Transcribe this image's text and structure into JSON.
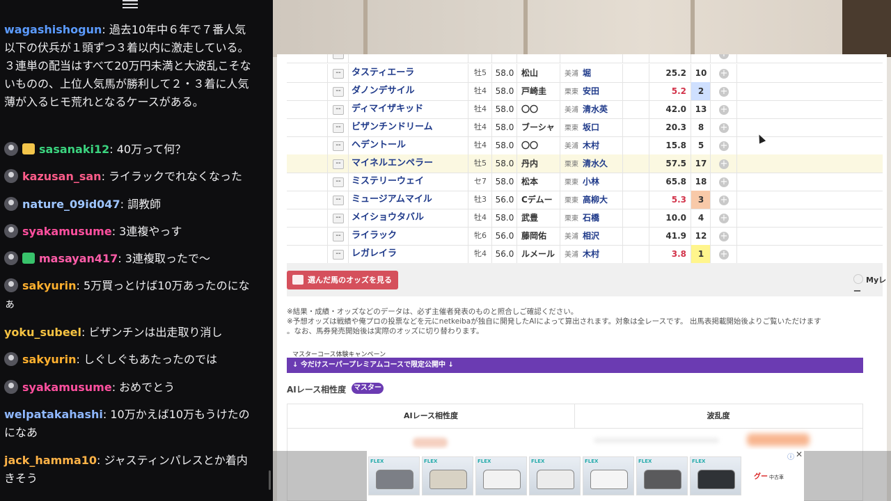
{
  "chat": {
    "messages": [
      {
        "user": "wagashishogun",
        "text": "過去10年中６年で７番人気以下の伏兵が１頭ずつ３着以内に激走している。３連単の配当はすべて20万円未満と大波乱こそないものの、上位人気馬が勝利して２・３着に人気薄が入るヒモ荒れとなるケースがある。",
        "color": "#5b9bff",
        "avatar": false,
        "badge": ""
      },
      {
        "user": "sasanaki12",
        "text": "40万って何？",
        "color": "#3bd47f",
        "avatar": true,
        "badge": "gift"
      },
      {
        "user": "kazusan_san",
        "text": "ライラックでれなくなった",
        "color": "#ff5c8a",
        "avatar": true,
        "badge": ""
      },
      {
        "user": "nature_09id047",
        "text": "調教師",
        "color": "#9ec5ff",
        "avatar": true,
        "badge": ""
      },
      {
        "user": "syakamusume",
        "text": "3連複やっす",
        "color": "#ff4f9e",
        "avatar": true,
        "badge": ""
      },
      {
        "user": "masayan417",
        "text": "3連複取ったで〜",
        "color": "#ff5ca8",
        "avatar": true,
        "badge": "green"
      },
      {
        "user": "sakyurin",
        "text": "5万買っとけば10万あったのになぁ",
        "color": "#ffb02e",
        "avatar": true,
        "badge": ""
      },
      {
        "user": "yoku_subeel",
        "text": "ビザンチンは出走取り消し",
        "color": "#f5c242",
        "avatar": false,
        "badge": ""
      },
      {
        "user": "sakyurin",
        "text": "しぐしぐもあたったのでは",
        "color": "#ffb02e",
        "avatar": true,
        "badge": ""
      },
      {
        "user": "syakamusume",
        "text": "おめでとう",
        "color": "#ff4f9e",
        "avatar": true,
        "badge": ""
      },
      {
        "user": "welpatakahashi",
        "text": "10万かえば10万もうけたのになあ",
        "color": "#8fb8ff",
        "avatar": false,
        "badge": ""
      },
      {
        "user": "jack_hamma10",
        "text": "ジャスティンパレスとか着内きそう",
        "color": "#ffb347",
        "avatar": false,
        "badge": ""
      }
    ]
  },
  "table": {
    "rows": [
      {
        "mark": "--",
        "name": "タスティエーラ",
        "sex": "牡5",
        "weight": "58.0",
        "jockey": "松山",
        "loc": "美浦",
        "trainer": "堀",
        "odds": "25.2",
        "pop": "10",
        "odds_red": false,
        "pop_class": ""
      },
      {
        "mark": "--",
        "name": "ダノンデサイル",
        "sex": "牡4",
        "weight": "58.0",
        "jockey": "戸崎圭",
        "loc": "栗東",
        "trainer": "安田",
        "odds": "5.2",
        "pop": "2",
        "odds_red": true,
        "pop_class": "p2"
      },
      {
        "mark": "--",
        "name": "ディマイザキッド",
        "sex": "牡4",
        "weight": "58.0",
        "jockey": "〇〇",
        "loc": "美浦",
        "trainer": "清水英",
        "odds": "42.0",
        "pop": "13",
        "odds_red": false,
        "pop_class": ""
      },
      {
        "mark": "--",
        "name": "ビザンチンドリーム",
        "sex": "牡4",
        "weight": "58.0",
        "jockey": "ブーシャ",
        "loc": "栗東",
        "trainer": "坂口",
        "odds": "20.3",
        "pop": "8",
        "odds_red": false,
        "pop_class": ""
      },
      {
        "mark": "--",
        "name": "ヘデントール",
        "sex": "牡4",
        "weight": "58.0",
        "jockey": "〇〇",
        "loc": "美浦",
        "trainer": "木村",
        "odds": "15.8",
        "pop": "5",
        "odds_red": false,
        "pop_class": ""
      },
      {
        "mark": "--",
        "name": "マイネルエンペラー",
        "sex": "牡5",
        "weight": "58.0",
        "jockey": "丹内",
        "loc": "栗東",
        "trainer": "清水久",
        "odds": "57.5",
        "pop": "17",
        "odds_red": false,
        "pop_class": "",
        "highlight": true
      },
      {
        "mark": "--",
        "name": "ミステリーウェイ",
        "sex": "セ7",
        "weight": "58.0",
        "jockey": "松本",
        "loc": "栗東",
        "trainer": "小林",
        "odds": "65.8",
        "pop": "18",
        "odds_red": false,
        "pop_class": ""
      },
      {
        "mark": "--",
        "name": "ミュージアムマイル",
        "sex": "牡3",
        "weight": "56.0",
        "jockey": "Cデムー",
        "loc": "栗東",
        "trainer": "高柳大",
        "odds": "5.3",
        "pop": "3",
        "odds_red": true,
        "pop_class": "p3"
      },
      {
        "mark": "--",
        "name": "メイショウタバル",
        "sex": "牡4",
        "weight": "58.0",
        "jockey": "武豊",
        "loc": "栗東",
        "trainer": "石橋",
        "odds": "10.0",
        "pop": "4",
        "odds_red": false,
        "pop_class": ""
      },
      {
        "mark": "--",
        "name": "ライラック",
        "sex": "牝6",
        "weight": "56.0",
        "jockey": "藤岡佑",
        "loc": "美浦",
        "trainer": "相沢",
        "odds": "41.9",
        "pop": "12",
        "odds_red": false,
        "pop_class": ""
      },
      {
        "mark": "--",
        "name": "レガレイラ",
        "sex": "牝4",
        "weight": "56.0",
        "jockey": "ルメール",
        "loc": "美浦",
        "trainer": "木村",
        "odds": "3.8",
        "pop": "1",
        "odds_red": true,
        "pop_class": "p1"
      }
    ]
  },
  "odds_button": "選んだ馬のオッズを見る",
  "my_label": "Myレー",
  "notes": [
    "※結果・成績・オッズなどのデータは、必ず主催者発表のものと照合しご確認ください。",
    "※予想オッズは戦績や俺プロの投票などを元にnetkeibaが独自に開発したAIによって算出されます。対象は全レースです。 出馬表掲載開始後よりご覧いただけます",
    "。なお、馬券発売開始後は実際のオッズに切り替わります。"
  ],
  "campaign": {
    "label": "マスターコース体験キャンペーン",
    "bar": "↓ 今だけスーパープレミアムコースで限定公開中 ↓"
  },
  "ai": {
    "title": "AIレース相性度",
    "badge": "マスター",
    "col1": "AIレース相性度",
    "col2": "波乱度"
  },
  "ad": {
    "brand": "グー",
    "brand_sub": "中古車",
    "car_tag": "FLEX"
  }
}
